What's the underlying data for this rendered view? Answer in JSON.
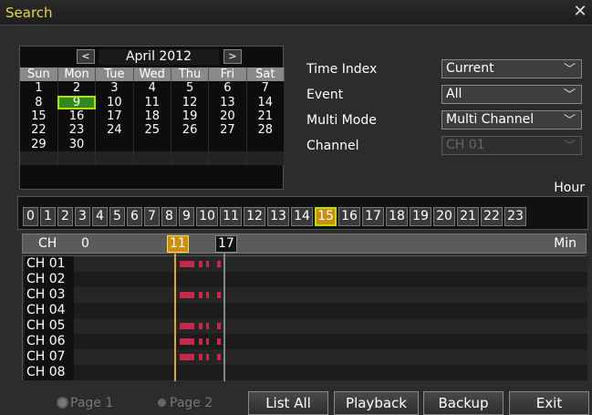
{
  "window": {
    "title": "Search",
    "close_glyph": "✕"
  },
  "calendar": {
    "month": "April 2012",
    "prev": "<",
    "next": ">",
    "days": [
      "Sun",
      "Mon",
      "Tue",
      "Wed",
      "Thu",
      "Fri",
      "Sat"
    ],
    "weeks": [
      [
        "1",
        "2",
        "3",
        "4",
        "5",
        "6",
        "7"
      ],
      [
        "8",
        "9",
        "10",
        "11",
        "12",
        "13",
        "14"
      ],
      [
        "15",
        "16",
        "17",
        "18",
        "19",
        "20",
        "21"
      ],
      [
        "22",
        "23",
        "24",
        "25",
        "26",
        "27",
        "28"
      ],
      [
        "29",
        "30",
        "",
        "",
        "",
        "",
        ""
      ],
      [
        "",
        "",
        "",
        "",
        "",
        "",
        ""
      ]
    ],
    "selected": "9"
  },
  "options": {
    "time_index": {
      "label": "Time Index",
      "value": "Current"
    },
    "event": {
      "label": "Event",
      "value": "All"
    },
    "multi_mode": {
      "label": "Multi Mode",
      "value": "Multi Channel"
    },
    "channel": {
      "label": "Channel",
      "value": "CH 01"
    }
  },
  "hour_label": "Hour",
  "hours": [
    "0",
    "1",
    "2",
    "3",
    "4",
    "5",
    "6",
    "7",
    "8",
    "9",
    "10",
    "11",
    "12",
    "13",
    "14",
    "15",
    "16",
    "17",
    "18",
    "19",
    "20",
    "21",
    "22",
    "23"
  ],
  "selected_hour": "15",
  "timeline": {
    "ch": "CH",
    "start": "0",
    "mark1": "11",
    "mark2": "17",
    "unit": "Min"
  },
  "channels": [
    "CH 01",
    "CH 02",
    "CH 03",
    "CH 04",
    "CH 05",
    "CH 06",
    "CH 07",
    "CH 08"
  ],
  "recording_channels": [
    "CH 01",
    "CH 03",
    "CH 05",
    "CH 06",
    "CH 07"
  ],
  "pages": {
    "page1": "Page 1",
    "page2": "Page 2"
  },
  "buttons": {
    "list_all": "List All",
    "playback": "Playback",
    "backup": "Backup",
    "exit": "Exit"
  },
  "colors": {
    "accent": "#b9e100",
    "highlight": "#ce8c12",
    "record": "#c8284a",
    "title": "#e8d44a"
  }
}
